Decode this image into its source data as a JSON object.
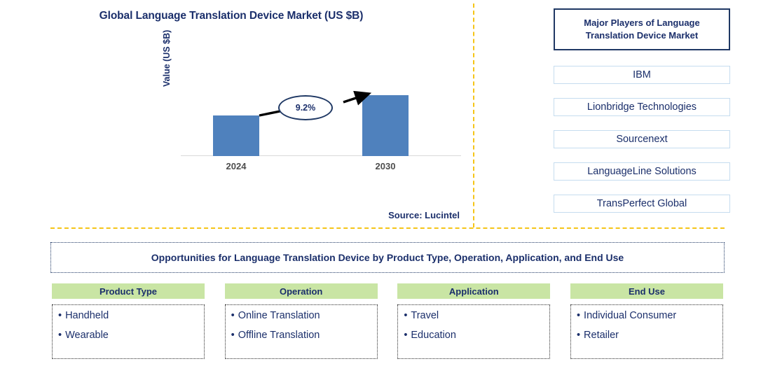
{
  "chart": {
    "title": "Global Language Translation Device Market (US $B)",
    "ylabel": "Value (US $B)",
    "cagr_label": "9.2%",
    "source": "Source: Lucintel"
  },
  "chart_data": {
    "type": "bar",
    "title": "Global Language Translation Device Market (US $B)",
    "xlabel": "",
    "ylabel": "Value (US $B)",
    "categories": [
      "2024",
      "2030"
    ],
    "values": [
      58,
      87
    ],
    "value_unit": "relative bar height (px, unlabeled axis)",
    "ylim": [
      0,
      100
    ],
    "grid": false,
    "legend": "none",
    "annotations": [
      {
        "type": "cagr-arrow",
        "text": "9.2%",
        "from_category": "2024",
        "to_category": "2030"
      }
    ],
    "colors": {
      "bar": "#4f81bd",
      "title": "#1b2f6b",
      "tick_label": "#4d4d4d",
      "axis_line": "#d9d9d9"
    }
  },
  "players": {
    "header": "Major Players of Language Translation Device Market",
    "items": [
      {
        "name": "IBM"
      },
      {
        "name": "Lionbridge Technologies"
      },
      {
        "name": "Sourcenext"
      },
      {
        "name": "LanguageLine Solutions"
      },
      {
        "name": "TransPerfect Global"
      }
    ]
  },
  "opportunities": {
    "title": "Opportunities for Language Translation Device by Product Type, Operation, Application, and End Use"
  },
  "categories": [
    {
      "header": "Product Type",
      "items": [
        "Handheld",
        "Wearable"
      ]
    },
    {
      "header": "Operation",
      "items": [
        "Online Translation",
        "Offline Translation"
      ]
    },
    {
      "header": "Application",
      "items": [
        "Travel",
        "Education"
      ]
    },
    {
      "header": "End Use",
      "items": [
        "Individual Consumer",
        "Retailer"
      ]
    }
  ],
  "theme": {
    "navy": "#1b2f6b",
    "bar_blue": "#4f81bd",
    "green": "#c9e5a4",
    "gold": "#f5c518"
  }
}
